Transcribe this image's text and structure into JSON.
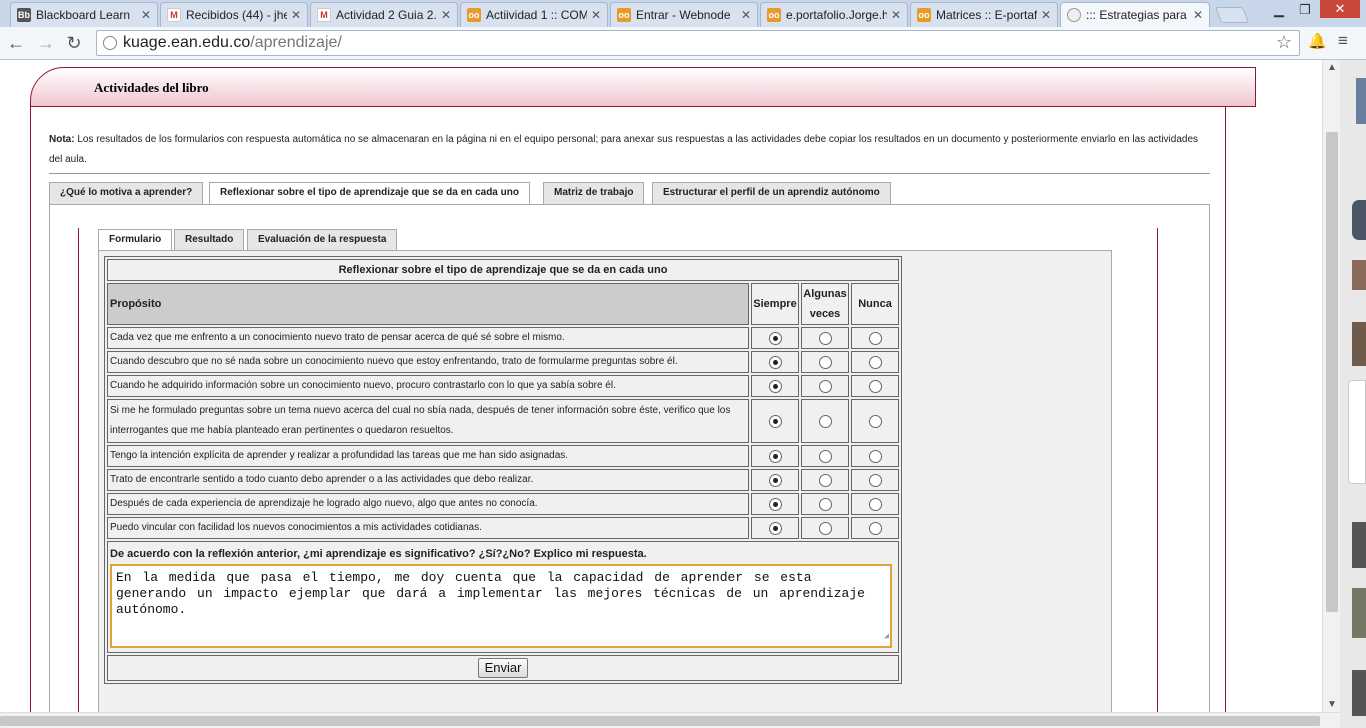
{
  "browser": {
    "tabs": [
      {
        "title": "Blackboard Learn",
        "icon": "blackboard-icon"
      },
      {
        "title": "Recibidos (44) - jhe",
        "icon": "gmail-icon"
      },
      {
        "title": "Actividad 2 Guia 2.",
        "icon": "gmail-icon"
      },
      {
        "title": "Actiividad 1 :: COM",
        "icon": "owl-icon"
      },
      {
        "title": "Entrar - Webnode",
        "icon": "owl-icon"
      },
      {
        "title": "e.portafolio.Jorge.h",
        "icon": "owl-icon"
      },
      {
        "title": "Matrices :: E-portaf",
        "icon": "owl-icon"
      },
      {
        "title": "::: Estrategias para",
        "icon": "globe-icon"
      }
    ],
    "url_host": "kuage.ean.edu.co",
    "url_path": "/aprendizaje/"
  },
  "page": {
    "header_title": "Actividades del libro",
    "nota_label": "Nota:",
    "nota_text": " Los resultados de los formularios con respuesta automática no se almacenaran en la página ni en el equipo personal; para anexar sus respuestas a las actividades debe copiar los resultados en un documento y posteriormente enviarlo en las actividades del aula.",
    "main_tabs": [
      "¿Qué lo motiva a aprender?",
      "Reflexionar sobre el tipo de aprendizaje que se da en cada uno",
      "Matriz de trabajo",
      "Estructurar el perfil de un aprendiz autónomo"
    ],
    "sub_tabs": [
      "Formulario",
      "Resultado",
      "Evaluación de la respuesta"
    ]
  },
  "form": {
    "caption": "Reflexionar sobre el tipo de aprendizaje que se da en cada uno",
    "col_proposito": "Propósito",
    "col_siempre": "Siempre",
    "col_algunas_1": "Algunas",
    "col_algunas_2": "veces",
    "col_nunca": "Nunca",
    "rows": [
      {
        "text": "Cada vez que me enfrento a un conocimiento nuevo trato de pensar acerca de qué sé sobre el mismo.",
        "selected": "siempre"
      },
      {
        "text": "Cuando descubro que no sé nada sobre un conocimiento nuevo que estoy enfrentando, trato de formularme preguntas sobre él.",
        "selected": "siempre"
      },
      {
        "text": "Cuando he adquirido información sobre un conocimiento nuevo, procuro contrastarlo con lo que ya sabía sobre él.",
        "selected": "siempre"
      },
      {
        "text": "Si me he formulado preguntas sobre un tema nuevo acerca del cual no sbía nada, después de tener información sobre éste, verifico que los interrogantes que me había planteado eran pertinentes o quedaron resueltos.",
        "selected": "siempre"
      },
      {
        "text": "Tengo la intención explícita de aprender y realizar a profundidad las tareas que me han sido asignadas.",
        "selected": "siempre"
      },
      {
        "text": "Trato de encontrarle sentido a todo cuanto debo aprender o a las actividades que debo realizar.",
        "selected": "siempre"
      },
      {
        "text": "Después de cada experiencia de aprendizaje he logrado algo nuevo, algo que antes no conocía.",
        "selected": "siempre"
      },
      {
        "text": "Puedo vincular con facilidad los nuevos conocimientos a mis actividades cotidianas.",
        "selected": "siempre"
      }
    ],
    "question_label": "De acuerdo con la reflexión anterior, ¿mi aprendizaje es significativo? ¿Sí?¿No? Explico mi respuesta.",
    "answer": "En la medida que pasa el tiempo, me doy cuenta que la capacidad de aprender se esta generando un impacto ejemplar que dará a implementar las mejores técnicas de un aprendizaje autónomo.",
    "submit_label": "Enviar"
  }
}
